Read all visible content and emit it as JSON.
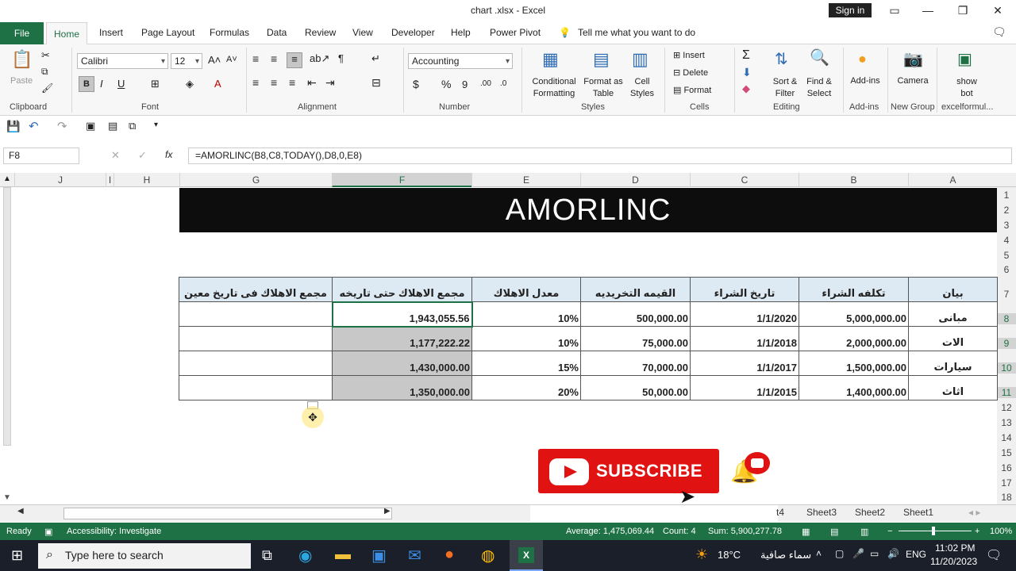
{
  "window": {
    "title": "chart .xlsx  -  Excel",
    "signin": "Sign in"
  },
  "tabs": [
    "File",
    "Home",
    "Insert",
    "Page Layout",
    "Formulas",
    "Data",
    "Review",
    "View",
    "Developer",
    "Help",
    "Power Pivot"
  ],
  "tell_me": "Tell me what you want to do",
  "ribbon": {
    "font_name": "Calibri",
    "font_size": "12",
    "number_format": "Accounting",
    "paste": "Paste",
    "groups": [
      "Clipboard",
      "Font",
      "Alignment",
      "Number",
      "Styles",
      "Cells",
      "Editing",
      "Add-ins",
      "New Group",
      "excelformul..."
    ],
    "cond_format": [
      "Conditional",
      "Formatting"
    ],
    "format_table": [
      "Format as",
      "Table"
    ],
    "cell_styles": [
      "Cell",
      "Styles"
    ],
    "insert": "Insert",
    "delete": "Delete",
    "format": "Format",
    "sort_filter": [
      "Sort &",
      "Filter"
    ],
    "find_select": [
      "Find &",
      "Select"
    ],
    "addins": "Add-ins",
    "camera": "Camera",
    "show_bot": [
      "show",
      "bot"
    ]
  },
  "formula_bar": {
    "name_box": "F8",
    "fx": "fx",
    "formula": "=AMORLINC(B8,C8,TODAY(),D8,0,E8)"
  },
  "columns": [
    "J",
    "I",
    "H",
    "G",
    "F",
    "E",
    "D",
    "C",
    "B",
    "A"
  ],
  "rows": [
    "1",
    "2",
    "3",
    "4",
    "5",
    "6",
    "7",
    "8",
    "9",
    "10",
    "11",
    "12",
    "13",
    "14",
    "15",
    "16",
    "17",
    "18"
  ],
  "banner": "AMORLINC",
  "table": {
    "headers": [
      "مجمع الاهلاك فى تاريخ معين",
      "مجمع الاهلاك حتى تاريخه",
      "معدل الاهلاك",
      "القيمه التخريديه",
      "تاريخ الشراء",
      "تكلفه الشراء",
      "بيان"
    ],
    "rows": [
      [
        "",
        "1,943,055.56",
        "10%",
        "500,000.00",
        "1/1/2020",
        "5,000,000.00",
        "مبانى"
      ],
      [
        "",
        "1,177,222.22",
        "10%",
        "75,000.00",
        "1/1/2018",
        "2,000,000.00",
        "الات"
      ],
      [
        "",
        "1,430,000.00",
        "15%",
        "70,000.00",
        "1/1/2017",
        "1,500,000.00",
        "سيارات"
      ],
      [
        "",
        "1,350,000.00",
        "20%",
        "50,000.00",
        "1/1/2015",
        "1,400,000.00",
        "اثاث"
      ]
    ]
  },
  "sheet_tabs": [
    "t4",
    "Sheet3",
    "Sheet2",
    "Sheet1"
  ],
  "status": {
    "ready": "Ready",
    "accessibility": "Accessibility: Investigate",
    "average": "Average: 1,475,069.44",
    "count": "Count: 4",
    "sum": "Sum: 5,900,277.78",
    "zoom": "100%"
  },
  "subscribe": "SUBSCRIBE",
  "taskbar": {
    "search": "Type here to search",
    "temp": "18°C",
    "weather": "سماء صافية",
    "lang": "ENG",
    "time": "11:02 PM",
    "date": "11/20/2023"
  },
  "colors": {
    "excel_green": "#1e7145",
    "banner_bg": "#0d0d0d",
    "header_fill": "#dde9f3",
    "selection_fill": "#c8c8c8",
    "subscribe_red": "#e01212"
  }
}
